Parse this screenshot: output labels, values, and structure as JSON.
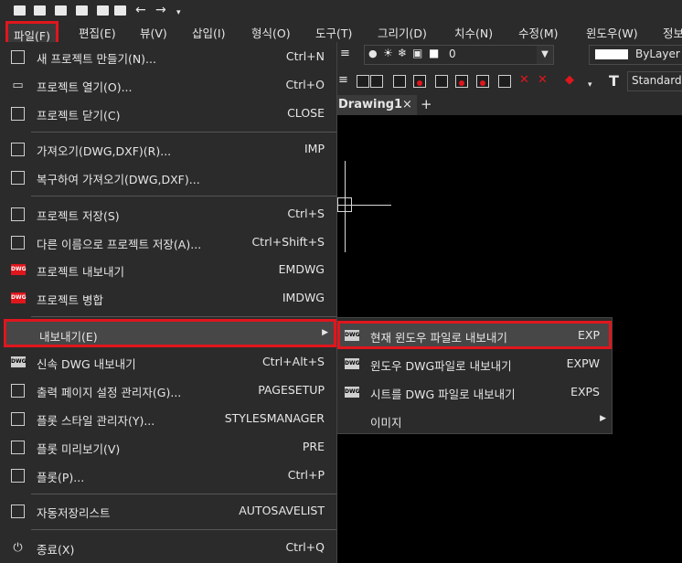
{
  "menubar": {
    "items": [
      {
        "label": "파일(F)",
        "active": true
      },
      {
        "label": "편집(E)"
      },
      {
        "label": "뷰(V)"
      },
      {
        "label": "삽입(I)"
      },
      {
        "label": "형식(O)"
      },
      {
        "label": "도구(T)"
      },
      {
        "label": "그리기(D)"
      },
      {
        "label": "치수(N)"
      },
      {
        "label": "수정(M)"
      },
      {
        "label": "윈도우(W)"
      },
      {
        "label": "정보"
      }
    ]
  },
  "toolbar": {
    "layer_value": "0",
    "color_value": "ByLayer",
    "textstyle_value": "Standard"
  },
  "document_tab": {
    "label": "Drawing1",
    "close": "×",
    "add": "+"
  },
  "file_menu": {
    "items": [
      {
        "label": "새 프로젝트 만들기(N)...",
        "shortcut": "Ctrl+N",
        "icon": "new-file-icon"
      },
      {
        "label": "프로젝트 열기(O)...",
        "shortcut": "Ctrl+O",
        "icon": "open-folder-icon"
      },
      {
        "label": "프로젝트 닫기(C)",
        "shortcut": "CLOSE",
        "icon": "close-file-icon"
      },
      {
        "label": "가져오기(DWG,DXF)(R)...",
        "shortcut": "IMP",
        "icon": "import-icon"
      },
      {
        "label": "복구하여 가져오기(DWG,DXF)...",
        "shortcut": "",
        "icon": "recover-icon"
      },
      {
        "label": "프로젝트 저장(S)",
        "shortcut": "Ctrl+S",
        "icon": "save-icon"
      },
      {
        "label": "다른 이름으로 프로젝트 저장(A)...",
        "shortcut": "Ctrl+Shift+S",
        "icon": "save-as-icon"
      },
      {
        "label": "프로젝트 내보내기",
        "shortcut": "EMDWG",
        "icon": "dwg-export-icon"
      },
      {
        "label": "프로젝트 병합",
        "shortcut": "IMDWG",
        "icon": "dwg-merge-icon"
      },
      {
        "label": "내보내기(E)",
        "shortcut": "",
        "icon": "",
        "submenu": true
      },
      {
        "label": "신속 DWG 내보내기",
        "shortcut": "Ctrl+Alt+S",
        "icon": "quick-dwg-icon"
      },
      {
        "label": "출력 페이지 설정 관리자(G)...",
        "shortcut": "PAGESETUP",
        "icon": "page-setup-icon"
      },
      {
        "label": "플롯 스타일 관리자(Y)...",
        "shortcut": "STYLESMANAGER",
        "icon": "plot-style-icon"
      },
      {
        "label": "플롯 미리보기(V)",
        "shortcut": "PRE",
        "icon": "plot-preview-icon"
      },
      {
        "label": "플롯(P)...",
        "shortcut": "Ctrl+P",
        "icon": "printer-icon"
      },
      {
        "label": "자동저장리스트",
        "shortcut": "AUTOSAVELIST",
        "icon": "autosave-icon"
      },
      {
        "label": "종료(X)",
        "shortcut": "Ctrl+Q",
        "icon": "power-icon"
      }
    ]
  },
  "export_submenu": {
    "items": [
      {
        "label": "현재 윈도우 파일로 내보내기",
        "shortcut": "EXP",
        "icon": "dwg-current-icon"
      },
      {
        "label": "윈도우 DWG파일로 내보내기",
        "shortcut": "EXPW",
        "icon": "dwg-window-icon"
      },
      {
        "label": "시트를 DWG 파일로 내보내기",
        "shortcut": "EXPS",
        "icon": "dwg-sheet-icon"
      },
      {
        "label": "이미지",
        "shortcut": "",
        "icon": "",
        "submenu": true
      }
    ]
  },
  "colors": {
    "highlight_frame": "#e0161d",
    "menu_bg": "#2b2b2b",
    "canvas_bg": "#000000"
  }
}
